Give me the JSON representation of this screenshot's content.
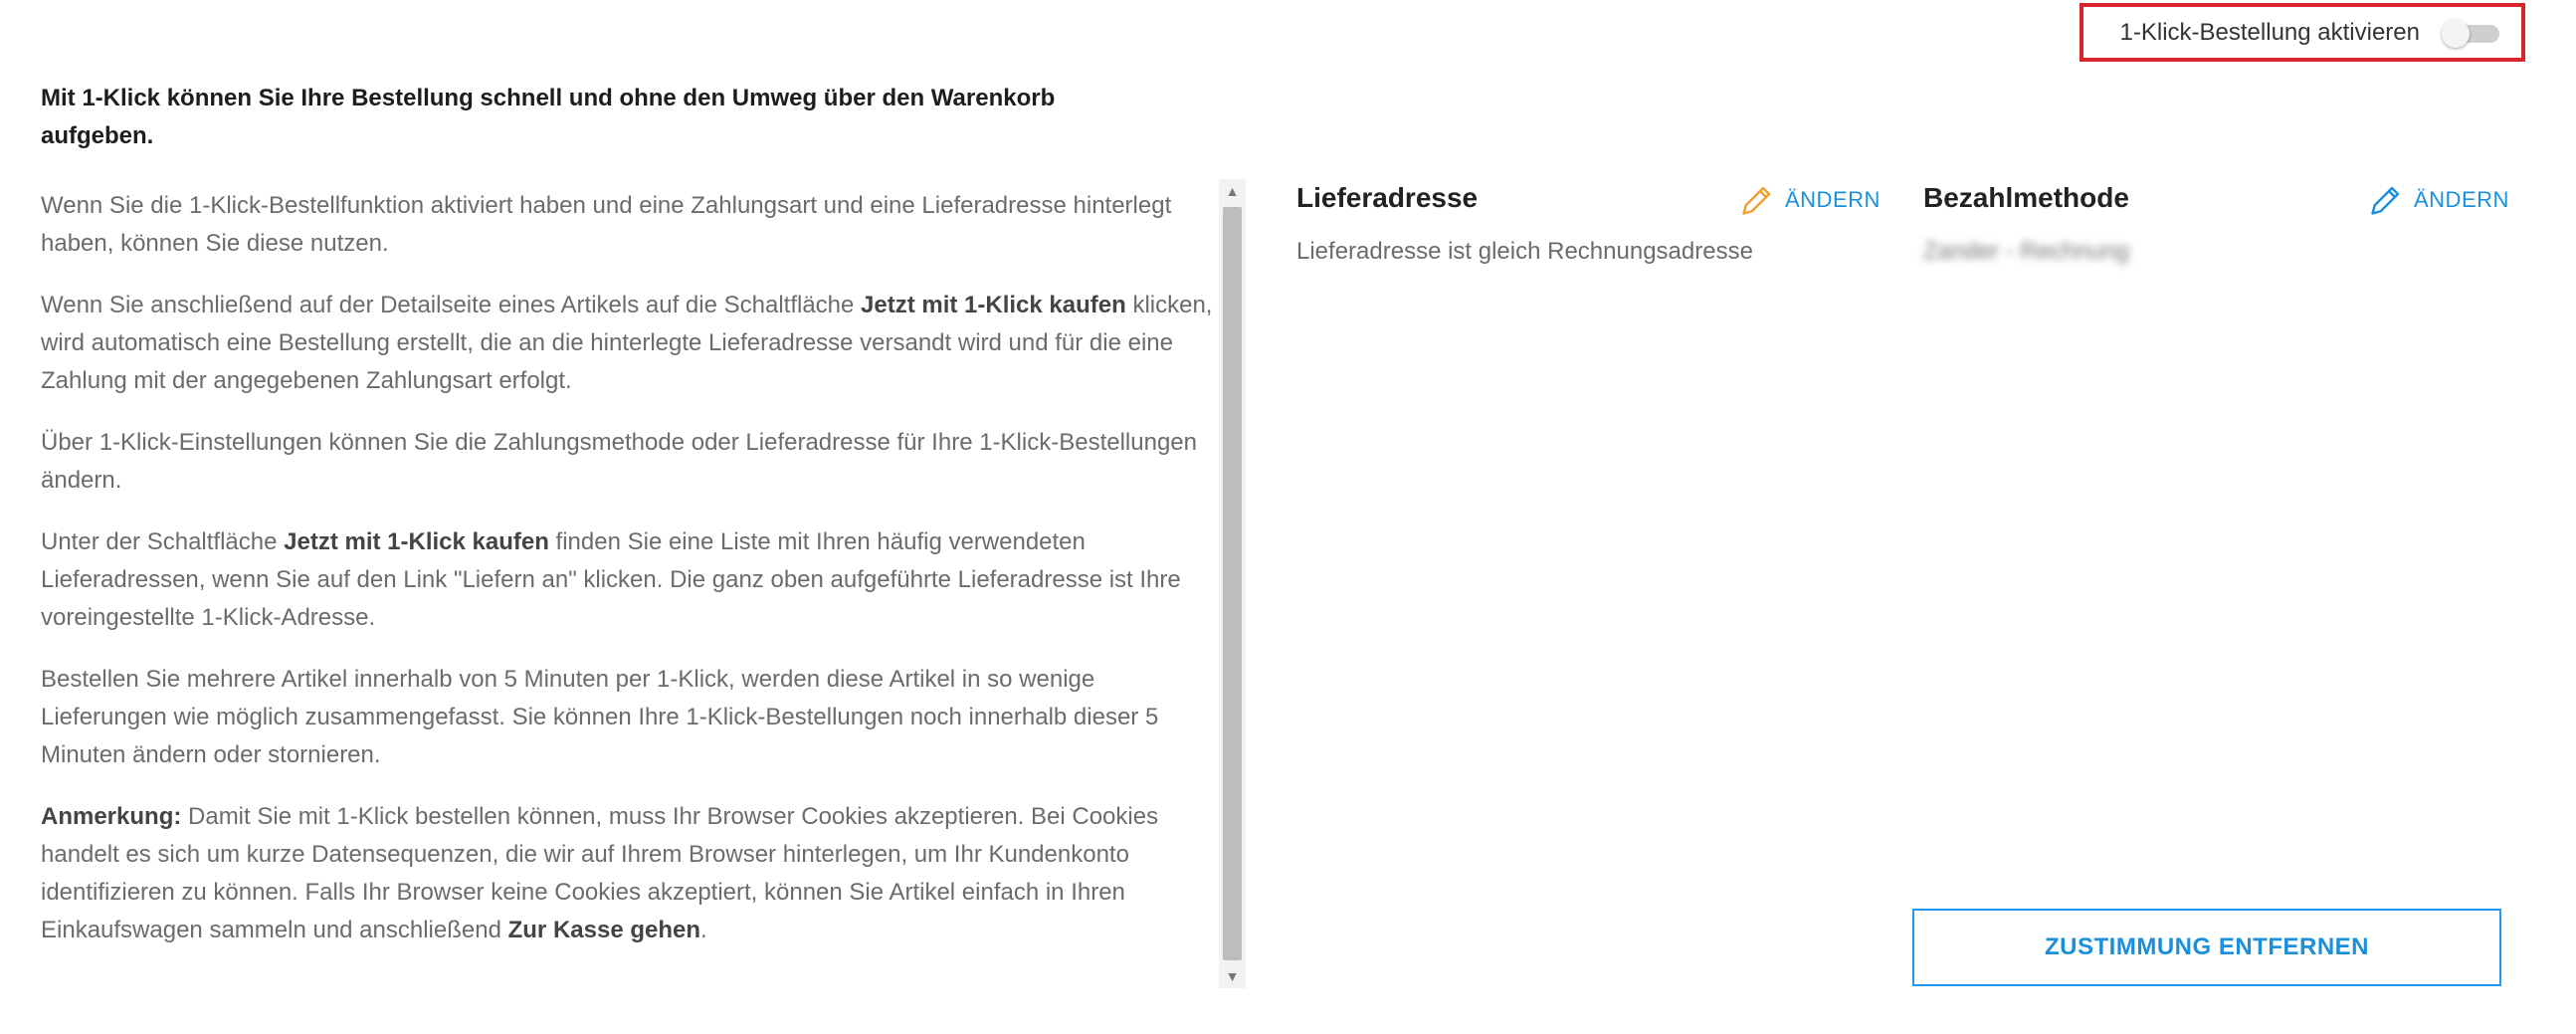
{
  "toggle": {
    "label": "1-Klick-Bestellung aktivieren",
    "enabled": false
  },
  "intro": "Mit 1-Klick können Sie Ihre Bestellung schnell und ohne den Umweg über den Warenkorb aufgeben.",
  "info": {
    "p1": "Wenn Sie die 1-Klick-Bestellfunktion aktiviert haben und eine Zahlungsart und eine Lieferadresse hinterlegt haben, können Sie diese nutzen.",
    "p2_before": "Wenn Sie anschließend auf der Detailseite eines Artikels auf die Schaltfläche ",
    "p2_bold": "Jetzt mit 1-Klick kaufen",
    "p2_after": " klicken, wird automatisch eine Bestellung erstellt, die an die hinterlegte Lieferadresse versandt wird und für die eine Zahlung mit der angegebenen Zahlungsart erfolgt.",
    "p3": "Über 1-Klick-Einstellungen können Sie die Zahlungsmethode oder Lieferadresse für Ihre 1-Klick-Bestellungen ändern.",
    "p4_before": "Unter der Schaltfläche ",
    "p4_bold": "Jetzt mit 1-Klick kaufen",
    "p4_after": " finden Sie eine Liste mit Ihren häufig verwendeten Lieferadressen, wenn Sie auf den Link \"Liefern an\" klicken. Die ganz oben aufgeführte Lieferadresse ist Ihre voreingestellte 1-Klick-Adresse.",
    "p5": "Bestellen Sie mehrere Artikel innerhalb von 5 Minuten per 1-Klick, werden diese Artikel in so wenige Lieferungen wie möglich zusammengefasst. Sie können Ihre 1-Klick-Bestellungen noch innerhalb dieser 5 Minuten ändern oder stornieren.",
    "p6_bold": "Anmerkung:",
    "p6_text": " Damit Sie mit 1-Klick bestellen können, muss Ihr Browser Cookies akzeptieren. Bei Cookies handelt es sich um kurze Datensequenzen, die wir auf Ihrem Browser hinterlegen, um Ihr Kundenkonto identifizieren zu können. Falls Ihr Browser keine Cookies akzeptiert, können Sie Artikel einfach in Ihren Einkaufswagen sammeln und anschließend ",
    "p6_bold2": "Zur Kasse gehen",
    "p6_end": "."
  },
  "delivery": {
    "title": "Lieferadresse",
    "edit_label": "ÄNDERN",
    "text": "Lieferadresse ist gleich Rechnungsadresse",
    "edit_icon": "pencil-icon",
    "edit_icon_color": "#f0a030"
  },
  "payment": {
    "title": "Bezahlmethode",
    "edit_label": "ÄNDERN",
    "text": "Zander - Rechnung",
    "edit_icon": "pencil-icon",
    "edit_icon_color": "#1a8fdc"
  },
  "remove_button": "ZUSTIMMUNG ENTFERNEN",
  "colors": {
    "accent": "#1a8fdc",
    "highlight": "#d9262c"
  }
}
